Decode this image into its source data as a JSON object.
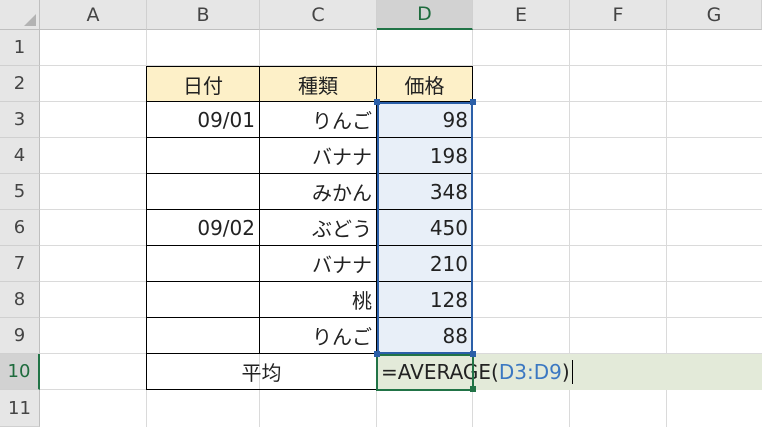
{
  "columns": [
    "A",
    "B",
    "C",
    "D",
    "E",
    "F",
    "G"
  ],
  "rows": [
    "1",
    "2",
    "3",
    "4",
    "5",
    "6",
    "7",
    "8",
    "9",
    "10",
    "11"
  ],
  "active_column": "D",
  "active_row": "10",
  "table": {
    "headers": [
      "日付",
      "種類",
      "価格"
    ],
    "data_rows": [
      {
        "date": "09/01",
        "type": "りんご",
        "price": "98"
      },
      {
        "date": "",
        "type": "バナナ",
        "price": "198"
      },
      {
        "date": "",
        "type": "みかん",
        "price": "348"
      },
      {
        "date": "09/02",
        "type": "ぶどう",
        "price": "450"
      },
      {
        "date": "",
        "type": "バナナ",
        "price": "210"
      },
      {
        "date": "",
        "type": "桃",
        "price": "128"
      },
      {
        "date": "",
        "type": "りんご",
        "price": "88"
      }
    ],
    "average_label": "平均"
  },
  "editing": {
    "prefix": "=AVERAGE(",
    "range": "D3:D9",
    "suffix": ")"
  },
  "colors": {
    "header_fill": "#fdf0c8",
    "range_fill": "#e8eff8",
    "range_border": "#2b5fa8",
    "active_green": "#217346",
    "edit_fill": "#e3ead9",
    "reference_text": "#3b78c2"
  }
}
